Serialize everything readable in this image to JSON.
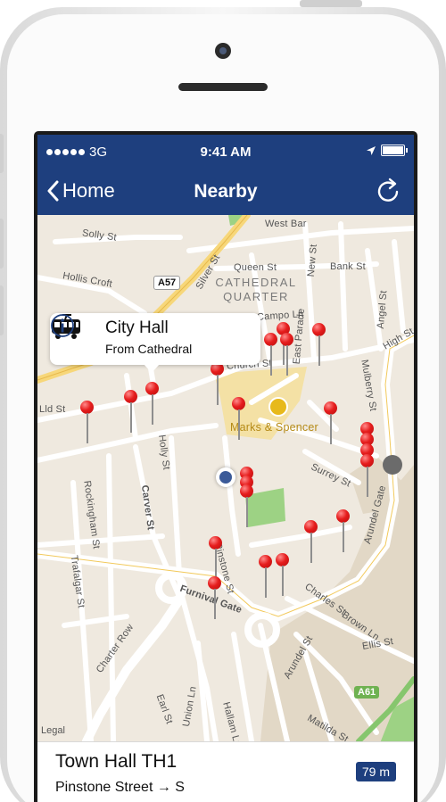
{
  "status_bar": {
    "carrier": "3G",
    "time": "9:41 AM"
  },
  "nav": {
    "back_label": "Home",
    "title": "Nearby"
  },
  "map": {
    "district": [
      "CATHEDRAL",
      "QUARTER"
    ],
    "roads": [
      "West Bar",
      "Solly St",
      "Hollis Croft",
      "Silver St",
      "Queen St",
      "Bank St",
      "Campo Ln",
      "Church St",
      "East Parade",
      "New St",
      "Angel St",
      "High St",
      "Mulberry St",
      "Surrey St",
      "Arundel Gate",
      "Carver St",
      "Holly St",
      "Rockingham St",
      "Trafalgar St",
      "Charter Row",
      "Pinstone St",
      "Furnival Gate",
      "Charles St",
      "Brown Ln",
      "Arundel St",
      "Earl St",
      "Union Ln",
      "Hallam Ln",
      "Matilda St",
      "Ellis St",
      "Lld St"
    ],
    "shields": [
      "A57",
      "A61"
    ],
    "poi": "Marks & Spencer",
    "legal": "Legal"
  },
  "callout": {
    "title": "City Hall",
    "subtitle": "From Cathedral"
  },
  "stop": {
    "name": "Town Hall TH1",
    "street": "Pinstone Street → S",
    "distance": "79 m"
  },
  "colors": {
    "nav": "#1e3f7e",
    "pin": "#e61d1d",
    "road_major": "#f7d77a",
    "park": "#9dd284",
    "map_bg": "#efe9df"
  }
}
